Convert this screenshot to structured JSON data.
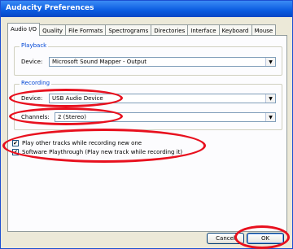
{
  "window": {
    "title": "Audacity Preferences"
  },
  "tabs": [
    {
      "label": "Audio I/O"
    },
    {
      "label": "Quality"
    },
    {
      "label": "File Formats"
    },
    {
      "label": "Spectrograms"
    },
    {
      "label": "Directories"
    },
    {
      "label": "Interface"
    },
    {
      "label": "Keyboard"
    },
    {
      "label": "Mouse"
    }
  ],
  "playback": {
    "group_label": "Playback",
    "device_label": "Device:",
    "device_value": "Microsoft Sound Mapper - Output"
  },
  "recording": {
    "group_label": "Recording",
    "device_label": "Device:",
    "device_value": "USB Audio Device",
    "channels_label": "Channels:",
    "channels_value": "2 (Stereo)"
  },
  "options": {
    "play_other": {
      "label": "Play other tracks while recording new one",
      "checked": true
    },
    "playthrough": {
      "label": "Software Playthrough (Play new track while recording it)",
      "checked": true
    }
  },
  "buttons": {
    "cancel": "Cancel",
    "ok": "OK"
  },
  "annotation_color": "#e8101e",
  "check_glyph": "✔",
  "dropdown_glyph": "▼"
}
